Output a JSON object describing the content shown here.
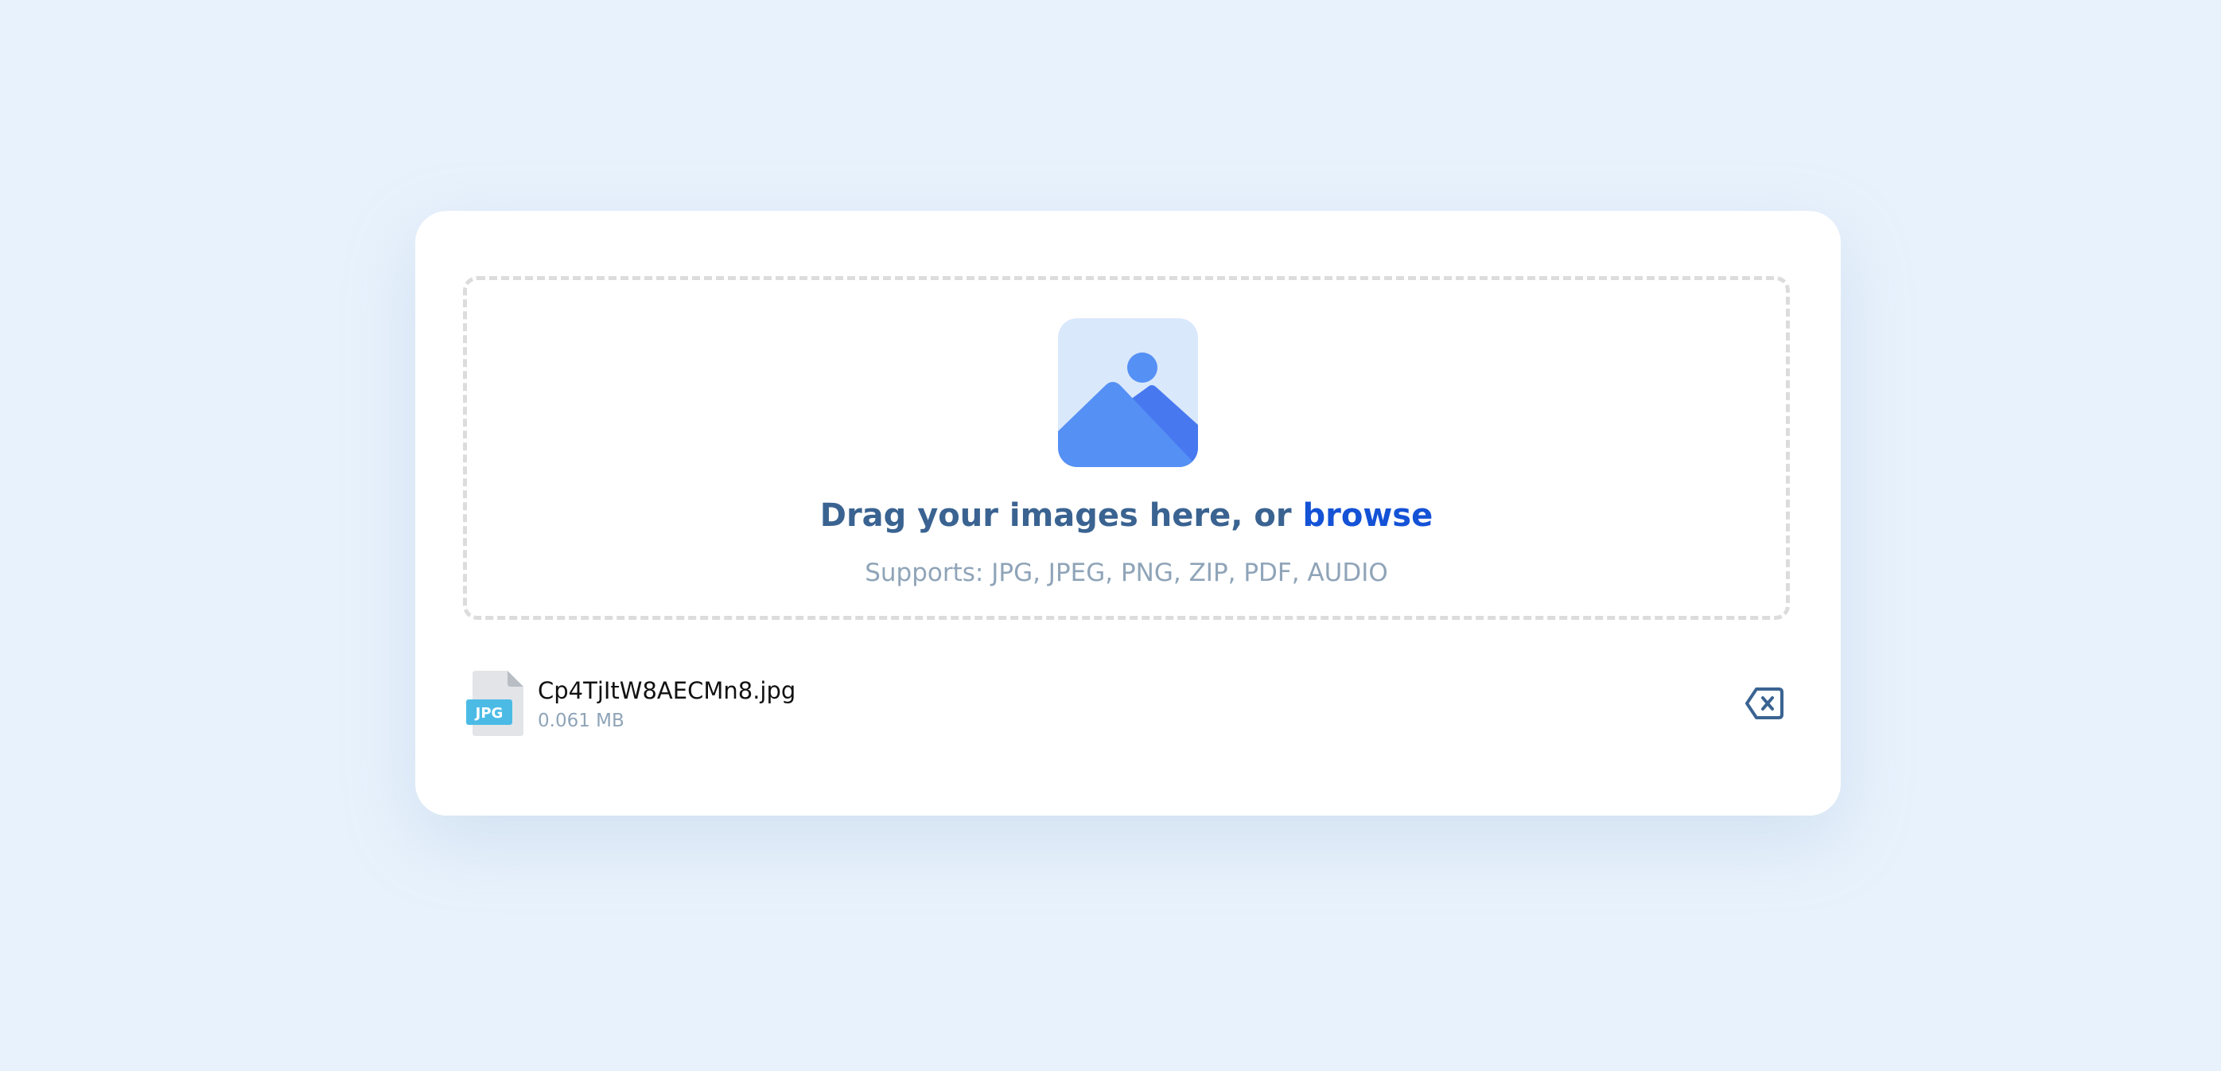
{
  "upload": {
    "title_prefix": "Drag your images here, or ",
    "browse_label": "browse",
    "supports_text": "Supports: JPG, JPEG, PNG, ZIP, PDF, AUDIO"
  },
  "files": [
    {
      "name": "Cp4TjItW8AECMn8.jpg",
      "size": "0.061 MB",
      "type_badge": "JPG",
      "remove_icon": "backspace-x-icon"
    }
  ],
  "colors": {
    "background": "#e8f2fc",
    "card": "#ffffff",
    "title": "#3a6391",
    "browse": "#1452d6",
    "muted": "#8fa4b8",
    "icon_blue": "#5590f5",
    "icon_dark_blue": "#4878f0",
    "icon_light": "#d9e8fb",
    "badge": "#4bbbe6",
    "remove": "#3a6391"
  }
}
